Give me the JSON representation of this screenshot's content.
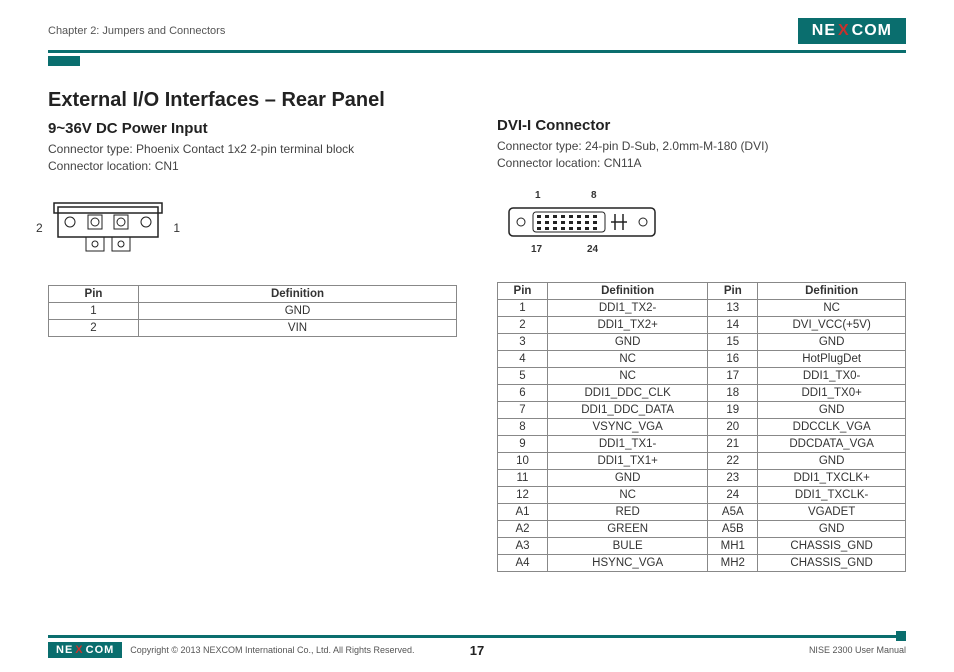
{
  "header": {
    "chapter": "Chapter 2: Jumpers and Connectors",
    "brand_pre": "NE",
    "brand_x": "X",
    "brand_post": "COM"
  },
  "title": "External I/O Interfaces – Rear Panel",
  "left": {
    "heading": "9~36V DC Power Input",
    "line1": "Connector type: Phoenix Contact 1x2 2-pin terminal block",
    "line2": "Connector location: CN1",
    "label2": "2",
    "label1": "1",
    "th_pin": "Pin",
    "th_def": "Definition",
    "rows": [
      {
        "pin": "1",
        "def": "GND"
      },
      {
        "pin": "2",
        "def": "VIN"
      }
    ]
  },
  "right": {
    "heading": "DVI-I Connector",
    "line1": "Connector type: 24-pin D-Sub, 2.0mm-M-180 (DVI)",
    "line2": "Connector location: CN11A",
    "num_tl": "1",
    "num_tr": "8",
    "num_bl": "17",
    "num_br": "24",
    "th_pin": "Pin",
    "th_def": "Definition",
    "rows": [
      {
        "p1": "1",
        "d1": "DDI1_TX2-",
        "p2": "13",
        "d2": "NC"
      },
      {
        "p1": "2",
        "d1": "DDI1_TX2+",
        "p2": "14",
        "d2": "DVI_VCC(+5V)"
      },
      {
        "p1": "3",
        "d1": "GND",
        "p2": "15",
        "d2": "GND"
      },
      {
        "p1": "4",
        "d1": "NC",
        "p2": "16",
        "d2": "HotPlugDet"
      },
      {
        "p1": "5",
        "d1": "NC",
        "p2": "17",
        "d2": "DDI1_TX0-"
      },
      {
        "p1": "6",
        "d1": "DDI1_DDC_CLK",
        "p2": "18",
        "d2": "DDI1_TX0+"
      },
      {
        "p1": "7",
        "d1": "DDI1_DDC_DATA",
        "p2": "19",
        "d2": "GND"
      },
      {
        "p1": "8",
        "d1": "VSYNC_VGA",
        "p2": "20",
        "d2": "DDCCLK_VGA"
      },
      {
        "p1": "9",
        "d1": "DDI1_TX1-",
        "p2": "21",
        "d2": "DDCDATA_VGA"
      },
      {
        "p1": "10",
        "d1": "DDI1_TX1+",
        "p2": "22",
        "d2": "GND"
      },
      {
        "p1": "11",
        "d1": "GND",
        "p2": "23",
        "d2": "DDI1_TXCLK+"
      },
      {
        "p1": "12",
        "d1": "NC",
        "p2": "24",
        "d2": "DDI1_TXCLK-"
      },
      {
        "p1": "A1",
        "d1": "RED",
        "p2": "A5A",
        "d2": "VGADET"
      },
      {
        "p1": "A2",
        "d1": "GREEN",
        "p2": "A5B",
        "d2": "GND"
      },
      {
        "p1": "A3",
        "d1": "BULE",
        "p2": "MH1",
        "d2": "CHASSIS_GND"
      },
      {
        "p1": "A4",
        "d1": "HSYNC_VGA",
        "p2": "MH2",
        "d2": "CHASSIS_GND"
      }
    ]
  },
  "footer": {
    "copyright": "Copyright © 2013 NEXCOM International Co., Ltd. All Rights Reserved.",
    "page": "17",
    "doc": "NISE 2300 User Manual"
  }
}
